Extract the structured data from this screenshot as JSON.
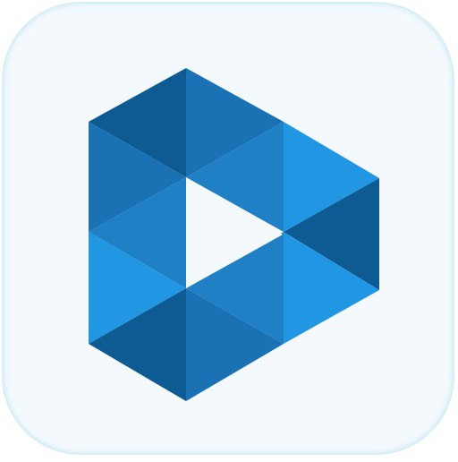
{
  "app_icon": {
    "icon_name": "video-player-play-logo-icon",
    "colors": {
      "tile_background": "#f3f9fd",
      "tile_border": "#d6eef6",
      "dark_blue": "#0e5a92",
      "mid_blue": "#1a72b5",
      "blue": "#1f80c6",
      "light_blue": "#2196e3",
      "play_cutout": "#f3f9fd"
    }
  }
}
